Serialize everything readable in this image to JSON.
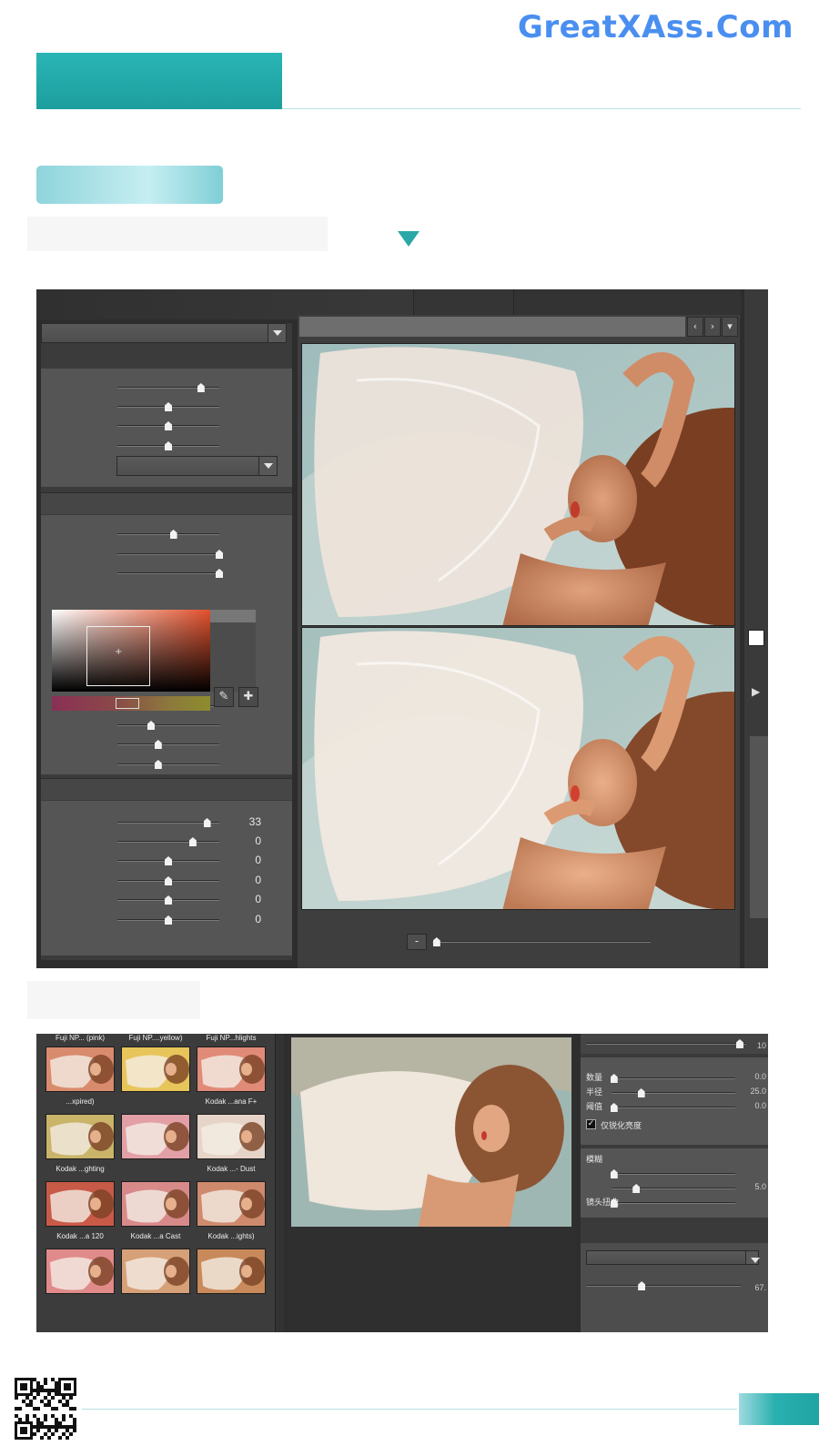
{
  "watermark": {
    "text": "GreatXAss.Com"
  },
  "colors": {
    "accent_teal": "#22aaaa",
    "brand_blue": "#4a8ff0",
    "panel_dark": "#2d2d2d",
    "panel_mid": "#555555"
  },
  "screenshot1": {
    "left_panel": {
      "section_sliders": [
        82,
        50,
        50,
        50
      ],
      "tone_sliders": [
        55,
        100,
        100
      ],
      "color_sliders": [
        46,
        33,
        40,
        40
      ],
      "detail_sliders": [
        {
          "pos": 88,
          "value": "33"
        },
        {
          "pos": 74,
          "value": "0"
        },
        {
          "pos": 50,
          "value": "0"
        },
        {
          "pos": 50,
          "value": "0"
        },
        {
          "pos": 50,
          "value": "0"
        },
        {
          "pos": 50,
          "value": "0"
        }
      ],
      "tools": [
        "eyedropper-icon",
        "eyedropper-plus-icon"
      ]
    },
    "viewer": {
      "nav_buttons": [
        "‹",
        "›",
        "▾"
      ],
      "zoom_button": "-"
    }
  },
  "screenshot2": {
    "filmstrip": {
      "top_labels": [
        "Fuji NP... (pink)",
        "Fuji NP....yellow)",
        "Fuji NP...hlights"
      ],
      "rows": [
        {
          "labels": [
            "...xpired)",
            "",
            "Kodak ...ana F+"
          ]
        },
        {
          "labels": [
            "Kodak ...ghting",
            "",
            "Kodak ...- Dust"
          ]
        },
        {
          "labels": [
            "Kodak ...a 120",
            "Kodak ...a Cast",
            "Kodak ...ights)"
          ]
        },
        {
          "labels": [
            "",
            "",
            ""
          ]
        }
      ]
    },
    "right_panel": {
      "top_value": "10",
      "sharpen": {
        "rows": [
          {
            "label": "数量",
            "value": "0.0"
          },
          {
            "label": "半径",
            "value": "25.0"
          },
          {
            "label": "阈值",
            "value": "0.0"
          }
        ],
        "checkbox_label": "仅锐化亮度",
        "checked": true
      },
      "blur": {
        "title": "模糊",
        "rows": [
          {
            "label": "",
            "value": ""
          },
          {
            "label": "",
            "value": "5.0"
          },
          {
            "label": "镜头扭曲",
            "value": ""
          }
        ]
      },
      "bottom_value": "67."
    }
  }
}
